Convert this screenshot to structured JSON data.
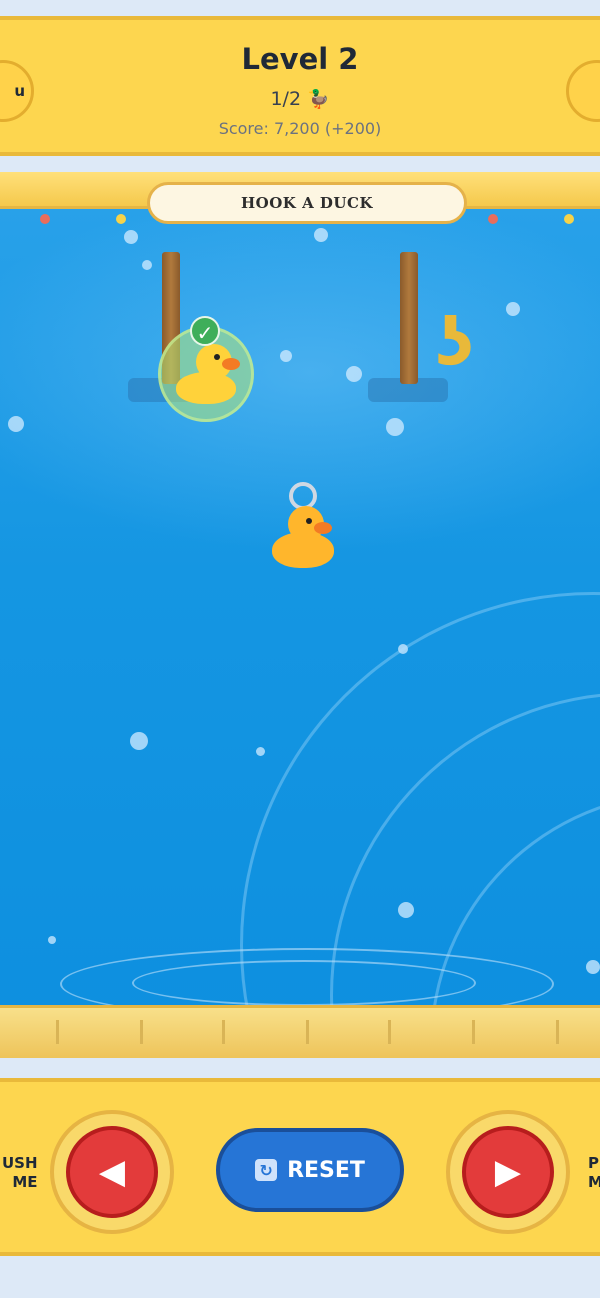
{
  "header": {
    "menu_label": "u",
    "title": "Level 2",
    "progress": "1/2",
    "progress_icon": "duck-icon",
    "score": "Score: 7,200 (+200)"
  },
  "game": {
    "banner": "HOOK A DUCK",
    "hooked_count": 1,
    "total_ducks": 2
  },
  "controls": {
    "left_side_text": [
      "USH",
      "ME"
    ],
    "left_arrow": "◀",
    "reset_icon": "refresh-icon",
    "reset_label": "RESET",
    "right_arrow": "▶",
    "right_side_text": [
      "P",
      "M"
    ]
  },
  "colors": {
    "header_bg": "#fdd64f",
    "water": "#1596e2",
    "arrow_button": "#e33b3b",
    "reset_button": "#2675d6"
  }
}
